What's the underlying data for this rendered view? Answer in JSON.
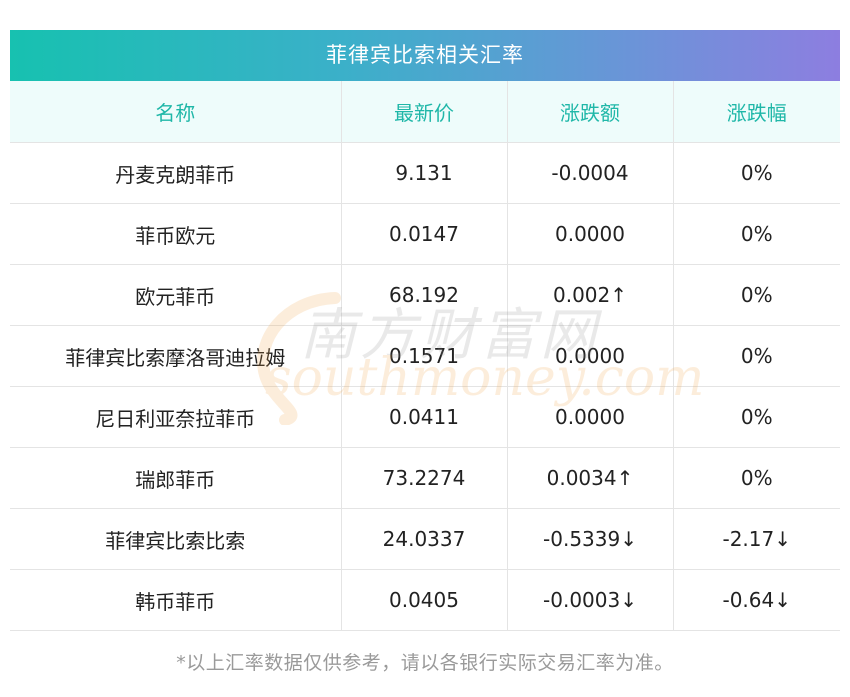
{
  "title": "菲律宾比索相关汇率",
  "headers": [
    "名称",
    "最新价",
    "涨跌额",
    "涨跌幅"
  ],
  "rows": [
    {
      "name": "丹麦克朗菲币",
      "price": "9.131",
      "change": "-0.0004",
      "pct": "0%",
      "price_class": "",
      "change_class": "",
      "pct_class": ""
    },
    {
      "name": "菲币欧元",
      "price": "0.0147",
      "change": "0.0000",
      "pct": "0%",
      "price_class": "",
      "change_class": "",
      "pct_class": ""
    },
    {
      "name": "欧元菲币",
      "price": "68.192",
      "change": "0.002↑",
      "pct": "0%",
      "price_class": "",
      "change_class": "up",
      "pct_class": ""
    },
    {
      "name": "菲律宾比索摩洛哥迪拉姆",
      "price": "0.1571",
      "change": "0.0000",
      "pct": "0%",
      "price_class": "",
      "change_class": "",
      "pct_class": ""
    },
    {
      "name": "尼日利亚奈拉菲币",
      "price": "0.0411",
      "change": "0.0000",
      "pct": "0%",
      "price_class": "",
      "change_class": "",
      "pct_class": ""
    },
    {
      "name": "瑞郎菲币",
      "price": "73.2274",
      "change": "0.0034↑",
      "pct": "0%",
      "price_class": "",
      "change_class": "up",
      "pct_class": ""
    },
    {
      "name": "菲律宾比索比索",
      "price": "24.0337",
      "change": "-0.5339↓",
      "pct": "-2.17↓",
      "price_class": "down",
      "change_class": "down",
      "pct_class": "down"
    },
    {
      "name": "韩币菲币",
      "price": "0.0405",
      "change": "-0.0003↓",
      "pct": "-0.64↓",
      "price_class": "down",
      "change_class": "down",
      "pct_class": "down"
    }
  ],
  "watermark": {
    "cn": "南方财富网",
    "en": "southmoney.com"
  },
  "footer": "*以上汇率数据仅供参考，请以各银行实际交易汇率为准。",
  "colors": {
    "up": "#e60012",
    "down": "#1a9a2c",
    "header_text": "#1fb7a8"
  }
}
